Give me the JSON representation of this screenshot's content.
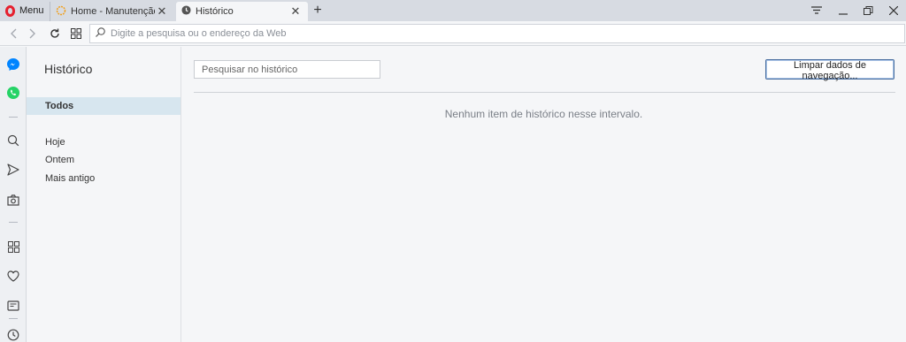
{
  "tabbar": {
    "menu_label": "Menu",
    "tabs": [
      {
        "label": "Home - Manutenção para",
        "icon": "site-icon"
      },
      {
        "label": "Histórico",
        "icon": "clock-icon"
      }
    ],
    "new_tab_label": "+"
  },
  "addressbar": {
    "placeholder": "Digite a pesquisa ou o endereço da Web"
  },
  "history": {
    "title": "Histórico",
    "items": [
      "Todos",
      "Hoje",
      "Ontem",
      "Mais antigo"
    ],
    "search_placeholder": "Pesquisar no histórico",
    "clear_button": "Limpar dados de navegação...",
    "empty_message": "Nenhum item de histórico nesse intervalo."
  },
  "colors": {
    "opera_red": "#e6202e",
    "messenger_blue": "#0084ff",
    "whatsapp_green": "#25d366",
    "active_item_bg": "#d7e6ef"
  }
}
